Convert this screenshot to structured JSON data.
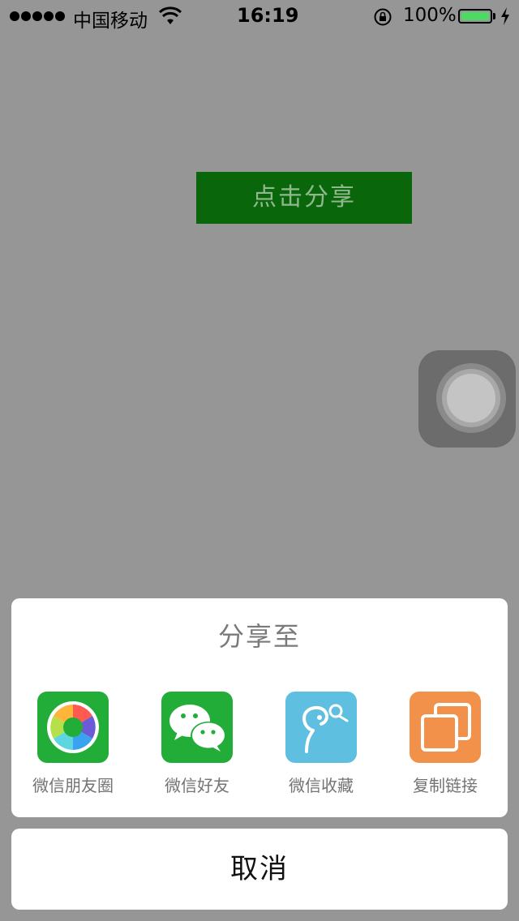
{
  "status_bar": {
    "carrier": "中国移动",
    "time": "16:19",
    "battery_percent": "100%",
    "icons": [
      "signal-dots-icon",
      "wifi-icon",
      "rotation-lock-icon",
      "battery-icon",
      "charging-bolt-icon"
    ],
    "battery_color": "#4cd964"
  },
  "main": {
    "share_button_label": "点击分享",
    "share_button_color": "#0a660a"
  },
  "share_sheet": {
    "title": "分享至",
    "options": [
      {
        "label": "微信朋友圈",
        "icon": "moments-aperture-icon",
        "color": "#22ac38"
      },
      {
        "label": "微信好友",
        "icon": "wechat-chat-icon",
        "color": "#22ac38"
      },
      {
        "label": "微信收藏",
        "icon": "favorites-icon",
        "color": "#5ebfe0"
      },
      {
        "label": "复制链接",
        "icon": "copy-link-icon",
        "color": "#f2914a"
      }
    ],
    "cancel_label": "取消"
  }
}
